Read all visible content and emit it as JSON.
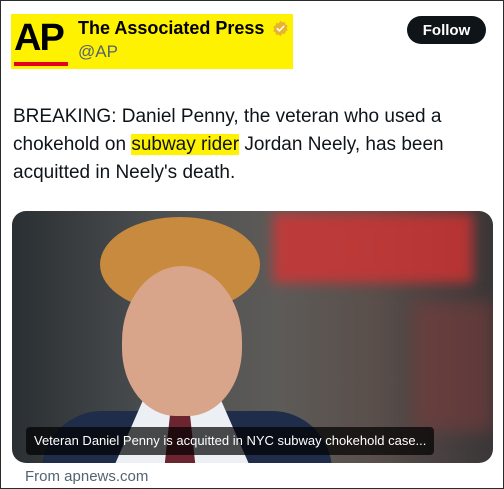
{
  "account": {
    "logo_text": "AP",
    "name": "The Associated Press",
    "handle": "@AP",
    "verified_icon": "verified-badge-icon",
    "highlight_color": "#fff200",
    "logo_bar_color": "#e5001a"
  },
  "follow_label": "Follow",
  "post": {
    "text_before": "BREAKING: Daniel Penny, the veteran who used a chokehold on ",
    "highlight": "subway rider",
    "text_after": " Jordan Neely, has been acquitted in Neely's death."
  },
  "media": {
    "caption": "Veteran Daniel Penny is acquitted in NYC subway chokehold case..."
  },
  "source": "From apnews.com"
}
